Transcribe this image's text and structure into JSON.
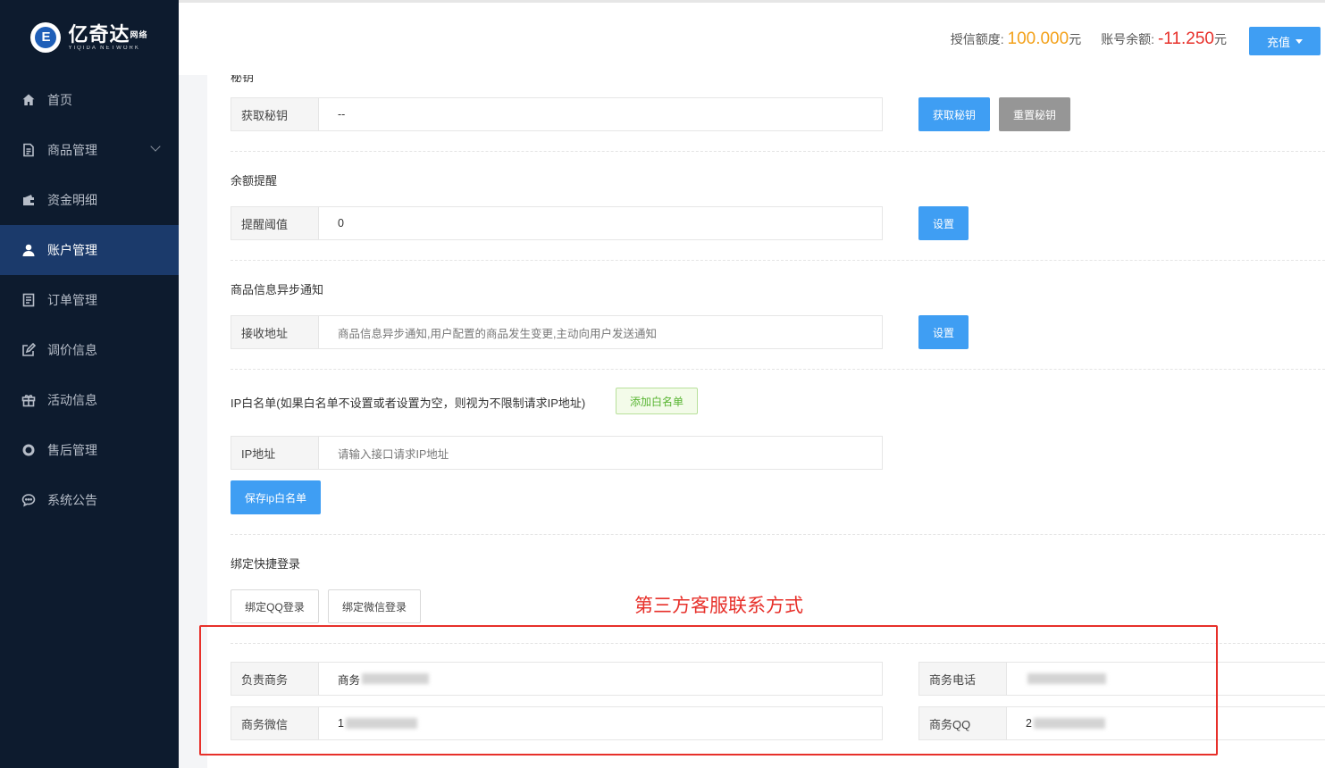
{
  "sidebar": {
    "logo": {
      "main": "亿奇达",
      "tag": "网络",
      "sub": "YIQIDA NETWORK"
    },
    "items": [
      {
        "label": "首页",
        "icon": "home-icon"
      },
      {
        "label": "商品管理",
        "icon": "document-icon",
        "has_submenu": true
      },
      {
        "label": "资金明细",
        "icon": "wallet-icon"
      },
      {
        "label": "账户管理",
        "icon": "user-icon",
        "active": true
      },
      {
        "label": "订单管理",
        "icon": "list-icon"
      },
      {
        "label": "调价信息",
        "icon": "edit-icon"
      },
      {
        "label": "活动信息",
        "icon": "gift-icon"
      },
      {
        "label": "售后管理",
        "icon": "lifebuoy-icon"
      },
      {
        "label": "系统公告",
        "icon": "chat-icon"
      }
    ]
  },
  "header": {
    "credit_label": "授信额度:",
    "credit_value": "100.000",
    "credit_unit": "元",
    "balance_label": "账号余额:",
    "balance_value": "-11.250",
    "balance_unit": "元",
    "recharge_label": "充值",
    "colors": {
      "credit": "#f3a11a",
      "balance": "#e7302a",
      "accent": "#3f9ef3"
    }
  },
  "secret": {
    "section_partial": "秘钥",
    "label": "获取秘钥",
    "value": "--",
    "get_button": "获取秘钥",
    "reset_button": "重置秘钥"
  },
  "balance_alert": {
    "title": "余额提醒",
    "label": "提醒阈值",
    "value": "0",
    "button": "设置"
  },
  "async_notify": {
    "title": "商品信息异步通知",
    "label": "接收地址",
    "placeholder": "商品信息异步通知,用户配置的商品发生变更,主动向用户发送通知",
    "button": "设置"
  },
  "ip_whitelist": {
    "title": "IP白名单(如果白名单不设置或者设置为空，则视为不限制请求IP地址)",
    "add_button": "添加白名单",
    "label": "IP地址",
    "placeholder": "请输入接口请求IP地址",
    "save_button": "保存ip白名单"
  },
  "quick_login": {
    "title": "绑定快捷登录",
    "qq_button": "绑定QQ登录",
    "wechat_button": "绑定微信登录"
  },
  "annotation": {
    "text": "第三方客服联系方式",
    "color": "#e7302a"
  },
  "contacts": {
    "manager_label": "负责商务",
    "manager_value": "商务",
    "phone_label": "商务电话",
    "phone_value": "",
    "wechat_label": "商务微信",
    "wechat_value": "1",
    "qq_label": "商务QQ",
    "qq_value": "2"
  }
}
